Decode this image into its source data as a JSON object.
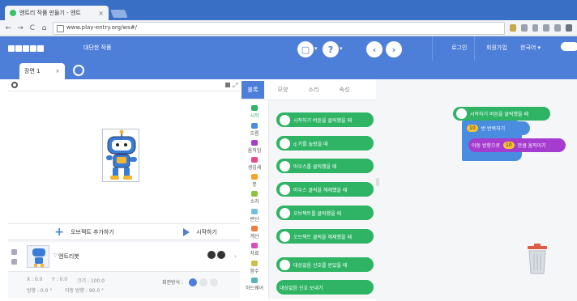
{
  "browser": {
    "tab_title": "엔트리 작품 만들기 - 엔트",
    "tab_close": "×",
    "url": "www.play-entry.org/ws#/",
    "back": "←",
    "forward": "→",
    "reload": "C",
    "home": "⌂"
  },
  "app": {
    "project_name": "대단한 작품",
    "header_buttons": [
      "로그인",
      "회원가입",
      "한국어 ▾"
    ],
    "scene_tab": "장면 1",
    "scene_close": "×"
  },
  "stage": {
    "add_object": "오브젝트 추가하기",
    "start": "시작하기"
  },
  "object": {
    "name": "엔트리봇",
    "x_label": "X : 0.0",
    "y_label": "Y : 0.0",
    "size_label": "크기 : 100.0",
    "dir_label": "방향 : 0.0 °",
    "move_dir_label": "이동 방향 : 90.0 °",
    "rotate_label": "회전방식 :"
  },
  "palette": {
    "tabs": [
      "블록",
      "모양",
      "소리",
      "속성"
    ],
    "categories": [
      "시작",
      "흐름",
      "움직임",
      "생김새",
      "붓",
      "소리",
      "판단",
      "계산",
      "자료",
      "함수",
      "하드웨어"
    ],
    "blocks": [
      "시작하기 버튼을 클릭했을 때",
      "q 키를 눌렀을 때",
      "마우스를 클릭했을 때",
      "마우스 클릭을 해제했을 때",
      "오브젝트를 클릭했을 때",
      "오브젝트 클릭을 해제했을 때",
      "대상없음 신호를 받았을 때",
      "대상없음 신호 보내기"
    ]
  },
  "workspace": {
    "start_block": "시작하기 버튼을 클릭했을 때",
    "repeat_count": "10",
    "repeat_label": "번 반복하기",
    "move_prefix": "이동 방향으로",
    "move_value": "10",
    "move_suffix": "만큼 움직이기"
  },
  "colors": {
    "brand_blue": "#4e7fd8",
    "start_green": "#2eb464",
    "flow_blue": "#4a8de0",
    "move_purple": "#a63ccf",
    "value_yellow": "#f5c432"
  }
}
